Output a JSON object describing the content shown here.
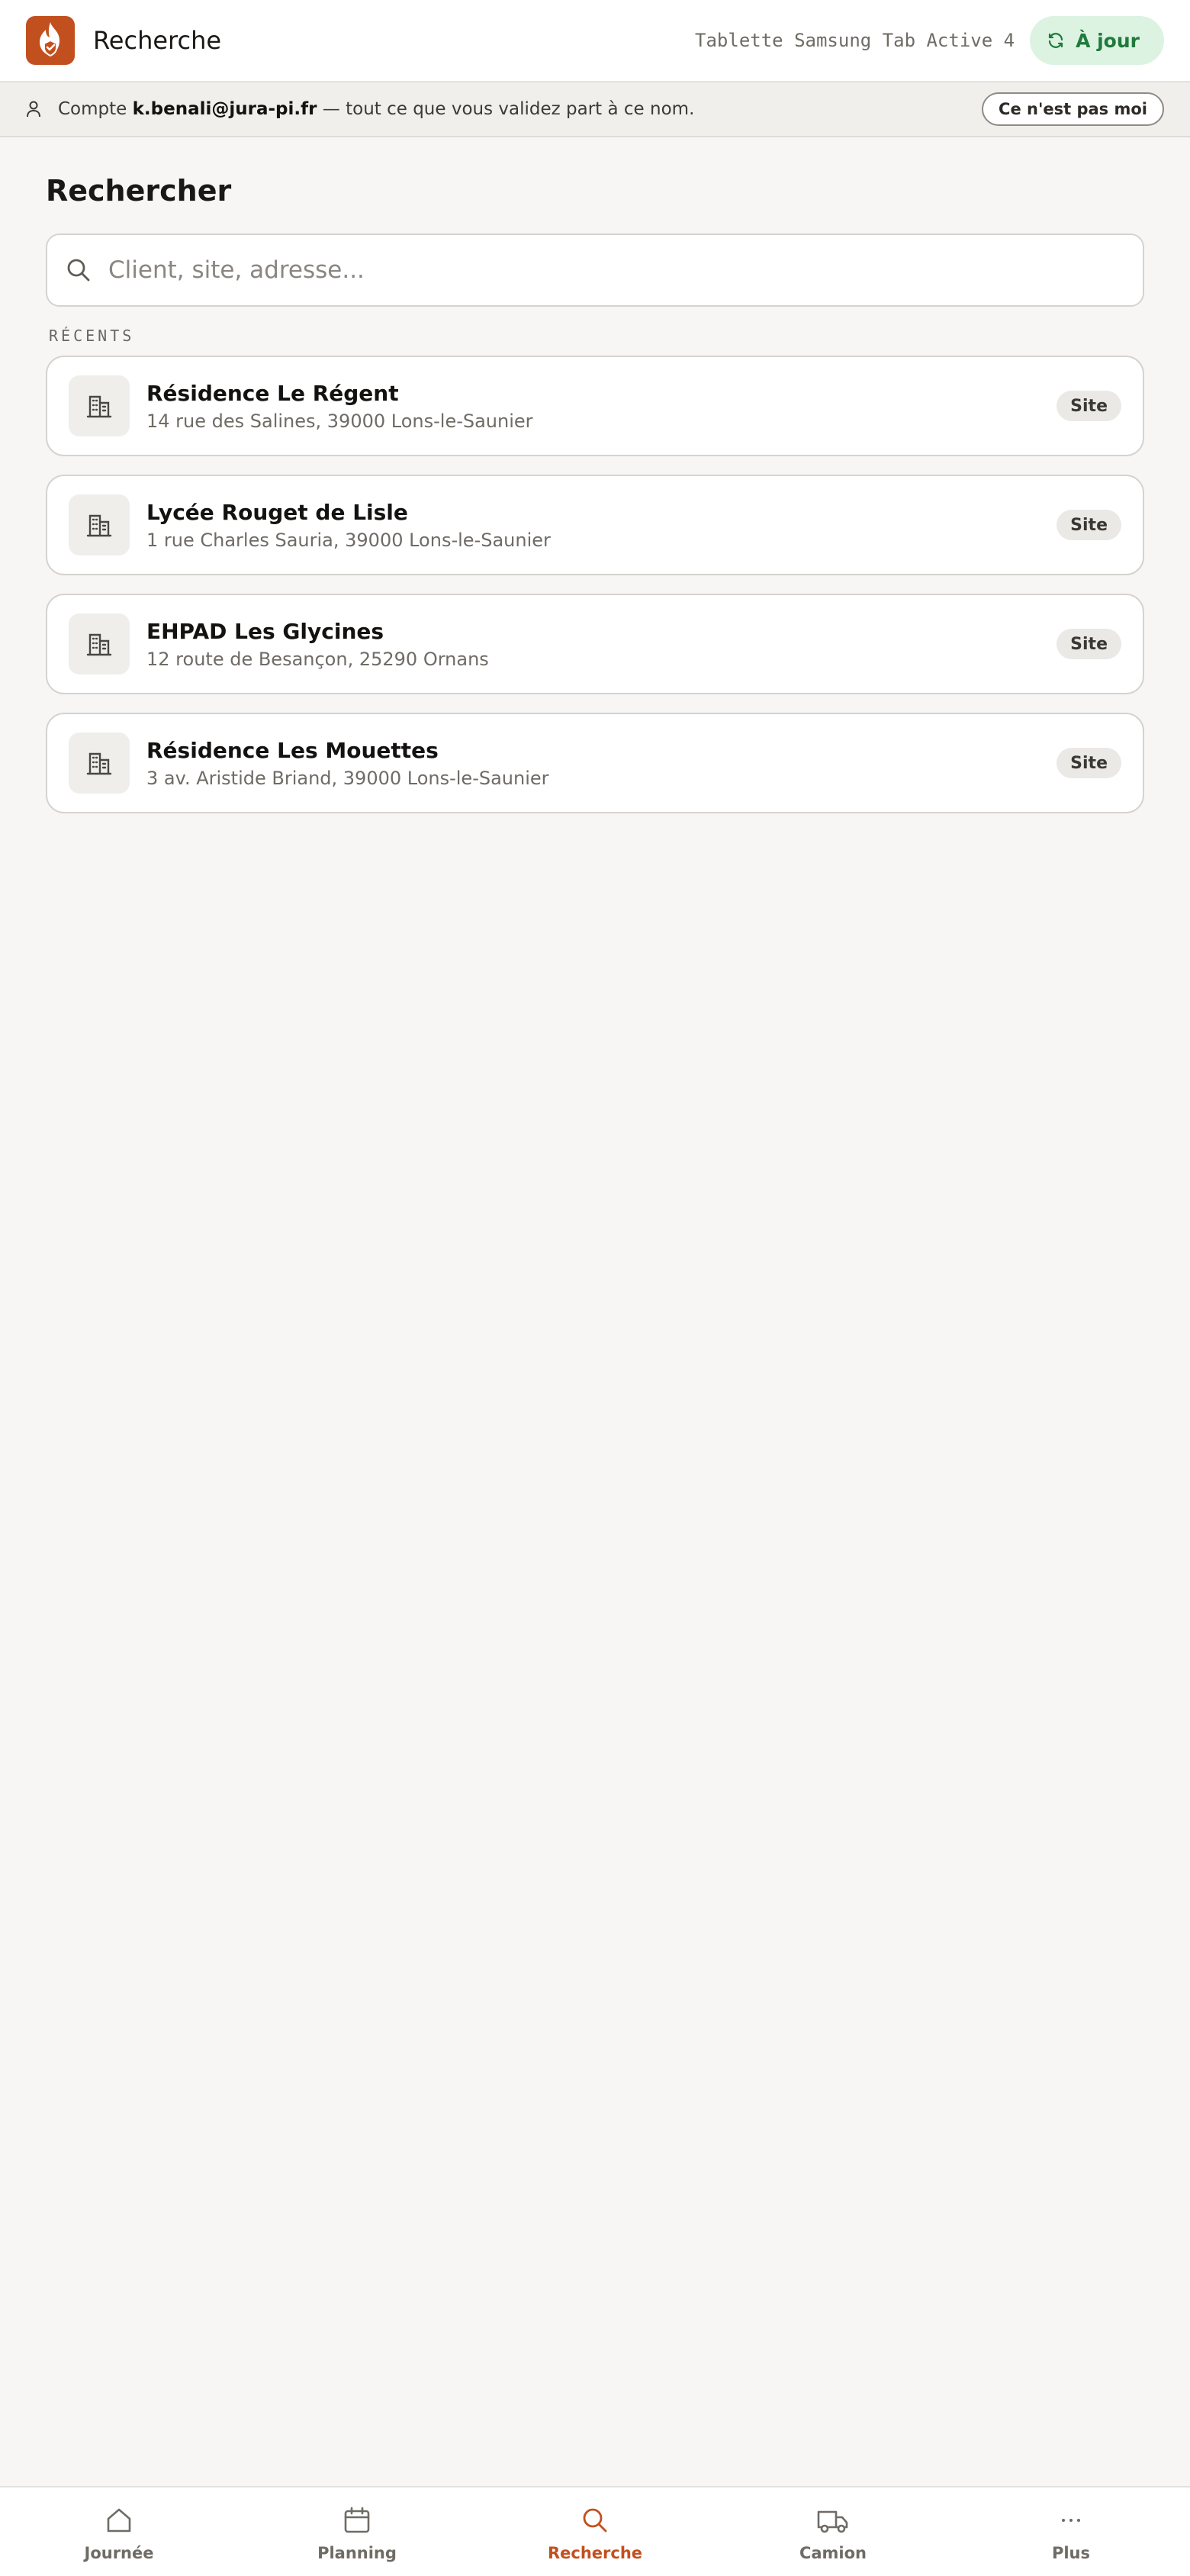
{
  "header": {
    "title": "Recherche",
    "device": "Tablette Samsung Tab Active 4",
    "sync_label": "À jour"
  },
  "account": {
    "prefix": "Compte ",
    "email": "k.benali@jura-pi.fr",
    "suffix": " — tout ce que vous validez part à ce nom.",
    "not_me_label": "Ce n'est pas moi"
  },
  "main": {
    "title": "Rechercher",
    "search_placeholder": "Client, site, adresse...",
    "recents_label": "RÉCENTS",
    "recents": [
      {
        "name": "Résidence Le Régent",
        "address": "14 rue des Salines, 39000 Lons-le-Saunier",
        "badge": "Site"
      },
      {
        "name": "Lycée Rouget de Lisle",
        "address": "1 rue Charles Sauria, 39000 Lons-le-Saunier",
        "badge": "Site"
      },
      {
        "name": "EHPAD Les Glycines",
        "address": "12 route de Besançon, 25290 Ornans",
        "badge": "Site"
      },
      {
        "name": "Résidence Les Mouettes",
        "address": "3 av. Aristide Briand, 39000 Lons-le-Saunier",
        "badge": "Site"
      }
    ]
  },
  "nav": {
    "items": [
      {
        "label": "Journée",
        "icon": "home-icon"
      },
      {
        "label": "Planning",
        "icon": "calendar-icon"
      },
      {
        "label": "Recherche",
        "icon": "search-icon",
        "active": true
      },
      {
        "label": "Camion",
        "icon": "truck-icon"
      },
      {
        "label": "Plus",
        "icon": "more-icon"
      }
    ]
  },
  "colors": {
    "brand": "#c2501f",
    "sync_bg": "#dcf3e2",
    "sync_text": "#1f7a3c",
    "background": "#f7f6f4"
  }
}
